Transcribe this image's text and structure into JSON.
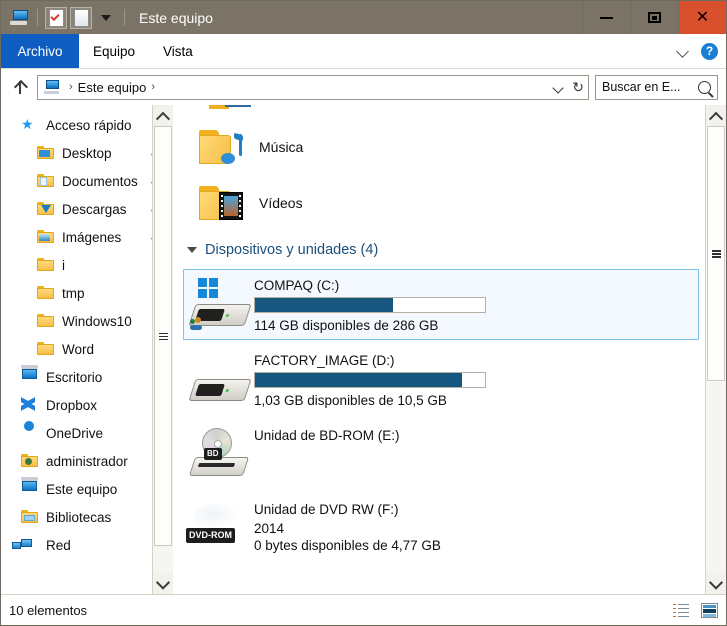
{
  "window": {
    "title": "Este equipo",
    "quick_access": [
      {
        "name": "computer-icon",
        "label": "Este equipo"
      },
      {
        "name": "properties-icon",
        "label": "Propiedades"
      },
      {
        "name": "new-folder-icon",
        "label": "Nueva carpeta"
      },
      {
        "name": "customize-dropdown-icon",
        "label": "Personalizar barra de herramientas de acceso rápido"
      }
    ],
    "controls": {
      "minimize": "Minimizar",
      "maximize": "Maximizar",
      "close": "Cerrar",
      "close_glyph": "✕",
      "close_color": "#d9512c"
    }
  },
  "ribbon": {
    "tabs": [
      {
        "label": "Archivo",
        "active": true
      },
      {
        "label": "Equipo",
        "active": false
      },
      {
        "label": "Vista",
        "active": false
      }
    ],
    "expand_label": "Expandir la cinta de opciones",
    "help_label": "?",
    "active_tab_color": "#0d5ec0"
  },
  "address": {
    "up_label": "Subir un nivel",
    "crumbs": [
      "Este equipo"
    ],
    "separator": "›",
    "dropdown_label": "Historial de ubicaciones",
    "refresh_glyph": "↻",
    "refresh_label": "Actualizar"
  },
  "search": {
    "placeholder": "Buscar en E...",
    "value": "Buscar en E...",
    "icon": "search-icon"
  },
  "sidebar": {
    "items": [
      {
        "label": "Acceso rápido",
        "icon": "star-icon",
        "indent": false,
        "pinned": false
      },
      {
        "label": "Desktop",
        "icon": "folder-desktop-icon",
        "indent": true,
        "pinned": true
      },
      {
        "label": "Documentos",
        "icon": "folder-documents-icon",
        "indent": true,
        "pinned": true
      },
      {
        "label": "Descargas",
        "icon": "folder-downloads-icon",
        "indent": true,
        "pinned": true
      },
      {
        "label": "Imágenes",
        "icon": "folder-pictures-icon",
        "indent": true,
        "pinned": true
      },
      {
        "label": "i",
        "icon": "folder-icon",
        "indent": true,
        "pinned": false
      },
      {
        "label": "tmp",
        "icon": "folder-icon",
        "indent": true,
        "pinned": false
      },
      {
        "label": "Windows10",
        "icon": "folder-icon",
        "indent": true,
        "pinned": false
      },
      {
        "label": "Word",
        "icon": "folder-icon",
        "indent": true,
        "pinned": false
      },
      {
        "label": "Escritorio",
        "icon": "desktop-icon",
        "indent": false,
        "pinned": false
      },
      {
        "label": "Dropbox",
        "icon": "dropbox-icon",
        "indent": false,
        "pinned": false
      },
      {
        "label": "OneDrive",
        "icon": "onedrive-cloud-icon",
        "indent": false,
        "pinned": false
      },
      {
        "label": "administrador",
        "icon": "user-folder-icon",
        "indent": false,
        "pinned": false
      },
      {
        "label": "Este equipo",
        "icon": "computer-icon",
        "indent": false,
        "pinned": false
      },
      {
        "label": "Bibliotecas",
        "icon": "libraries-icon",
        "indent": false,
        "pinned": false
      },
      {
        "label": "Red",
        "icon": "network-icon",
        "indent": false,
        "pinned": false
      }
    ]
  },
  "content": {
    "folders": [
      {
        "label": "Música",
        "icon": "music-folder-icon"
      },
      {
        "label": "Vídeos",
        "icon": "video-folder-icon"
      }
    ],
    "group": {
      "title": "Dispositivos y unidades (4)",
      "expanded": true
    },
    "drives": [
      {
        "name": "COMPAQ (C:)",
        "icon": "hard-drive-windows-icon",
        "selected": true,
        "has_bar": true,
        "fill_percent": 60,
        "capacity_text": "114 GB disponibles de 286 GB",
        "free": "114 GB",
        "total": "286 GB",
        "badge": "",
        "volume_label": ""
      },
      {
        "name": "FACTORY_IMAGE (D:)",
        "icon": "hard-drive-icon",
        "selected": false,
        "has_bar": true,
        "fill_percent": 90,
        "capacity_text": "1,03 GB disponibles de 10,5 GB",
        "free": "1,03 GB",
        "total": "10,5 GB",
        "badge": "",
        "volume_label": ""
      },
      {
        "name": "Unidad de BD-ROM (E:)",
        "icon": "bd-rom-drive-icon",
        "selected": false,
        "has_bar": false,
        "fill_percent": 0,
        "capacity_text": "",
        "free": "",
        "total": "",
        "badge": "BD",
        "volume_label": ""
      },
      {
        "name": "Unidad de DVD RW (F:)",
        "icon": "dvd-rw-drive-icon",
        "selected": false,
        "has_bar": false,
        "fill_percent": 0,
        "capacity_text": "0 bytes disponibles de 4,77 GB",
        "free": "0 bytes",
        "total": "4,77 GB",
        "badge": "DVD-ROM",
        "volume_label": "2014"
      }
    ],
    "bar_fill_color": "#15577f",
    "selection_border_color": "#7cc0ec"
  },
  "status": {
    "items_text": "10 elementos",
    "view_buttons": [
      {
        "name": "details-view-button",
        "label": "Detalles"
      },
      {
        "name": "large-icons-view-button",
        "label": "Iconos grandes"
      }
    ]
  },
  "scrollbars": {
    "nav_up": "▲",
    "nav_down": "▼",
    "content_up": "▲",
    "content_down": "▼"
  }
}
